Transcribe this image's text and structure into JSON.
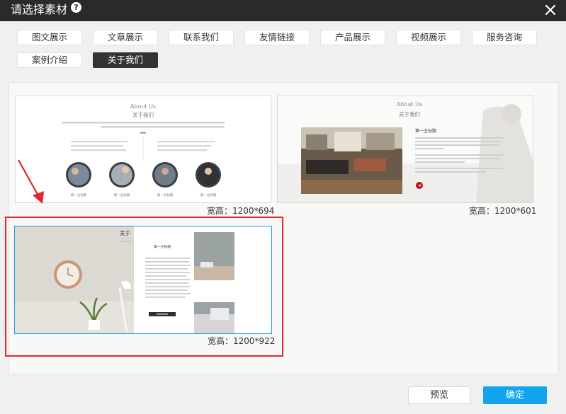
{
  "dialog": {
    "title": "请选择素材",
    "help_glyph": "?"
  },
  "tabs": [
    {
      "label": "图文展示"
    },
    {
      "label": "文章展示"
    },
    {
      "label": "联系我们"
    },
    {
      "label": "友情链接"
    },
    {
      "label": "产品展示"
    },
    {
      "label": "视频展示"
    },
    {
      "label": "服务咨询"
    },
    {
      "label": "案例介绍"
    },
    {
      "label": "关于我们",
      "active": true
    }
  ],
  "templates": [
    {
      "dims": "宽高：1200*694",
      "title_en": "About Us",
      "title_cn": "关于我们",
      "captions": [
        "第一主标题",
        "第一主标题",
        "第一主标题",
        "第一主标题"
      ]
    },
    {
      "dims": "宽高：1200*601",
      "title_en": "About Us",
      "title_cn": "关于我们",
      "heading": "第一主标题"
    },
    {
      "dims": "宽高：1200*922",
      "title_cn": "关于",
      "heading": "第一主标题",
      "selected": true
    }
  ],
  "buttons": {
    "preview": "预览",
    "confirm": "确定"
  },
  "colors": {
    "titlebar": "#2a2a2a",
    "active_tab": "#333333",
    "selection_border": "#e2262c",
    "selected_thumb_border": "#1e9be6",
    "confirm_button": "#11a5f0",
    "accent_red": "#b3161c"
  },
  "icons": {
    "help": "help-icon",
    "close": "close-icon",
    "arrow": "red-arrow-icon"
  }
}
